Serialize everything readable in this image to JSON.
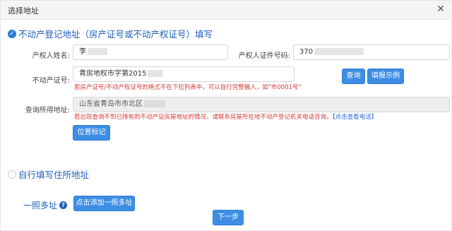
{
  "dialog": {
    "title": "选择地址",
    "close_glyph": "✕"
  },
  "section1": {
    "title": "不动产登记地址（房产证号或不动产权证号）填写"
  },
  "form": {
    "owner_name_label": "产权人姓名:",
    "owner_name_value": "李",
    "owner_id_label": "产权人证件号码:",
    "owner_id_value": "370",
    "cert_label": "不动产证号:",
    "cert_value": "青房地权市字第2015",
    "cert_hint": "若房产证号/不动产权证号的格式不在下拉列表中，可以自行完整输入，如\"市0001号\"",
    "query_btn": "查询",
    "example_btn": "填报示例",
    "result_label": "查询所得地址:",
    "result_value": "山东省青岛市市北区",
    "result_hint": "若出现查询不到已持有的不动产证房屋地址的情况，请联系房屋所在地不动产登记机关电话咨询。",
    "result_hint_link": "【点击查看电话】",
    "locate_btn": "位置标记"
  },
  "section2": {
    "title": "自行填写住所地址"
  },
  "multi": {
    "label": "一照多址",
    "help_glyph": "?",
    "add_btn": "点击添加一照多址"
  },
  "footer": {
    "next_btn": "下一步"
  }
}
